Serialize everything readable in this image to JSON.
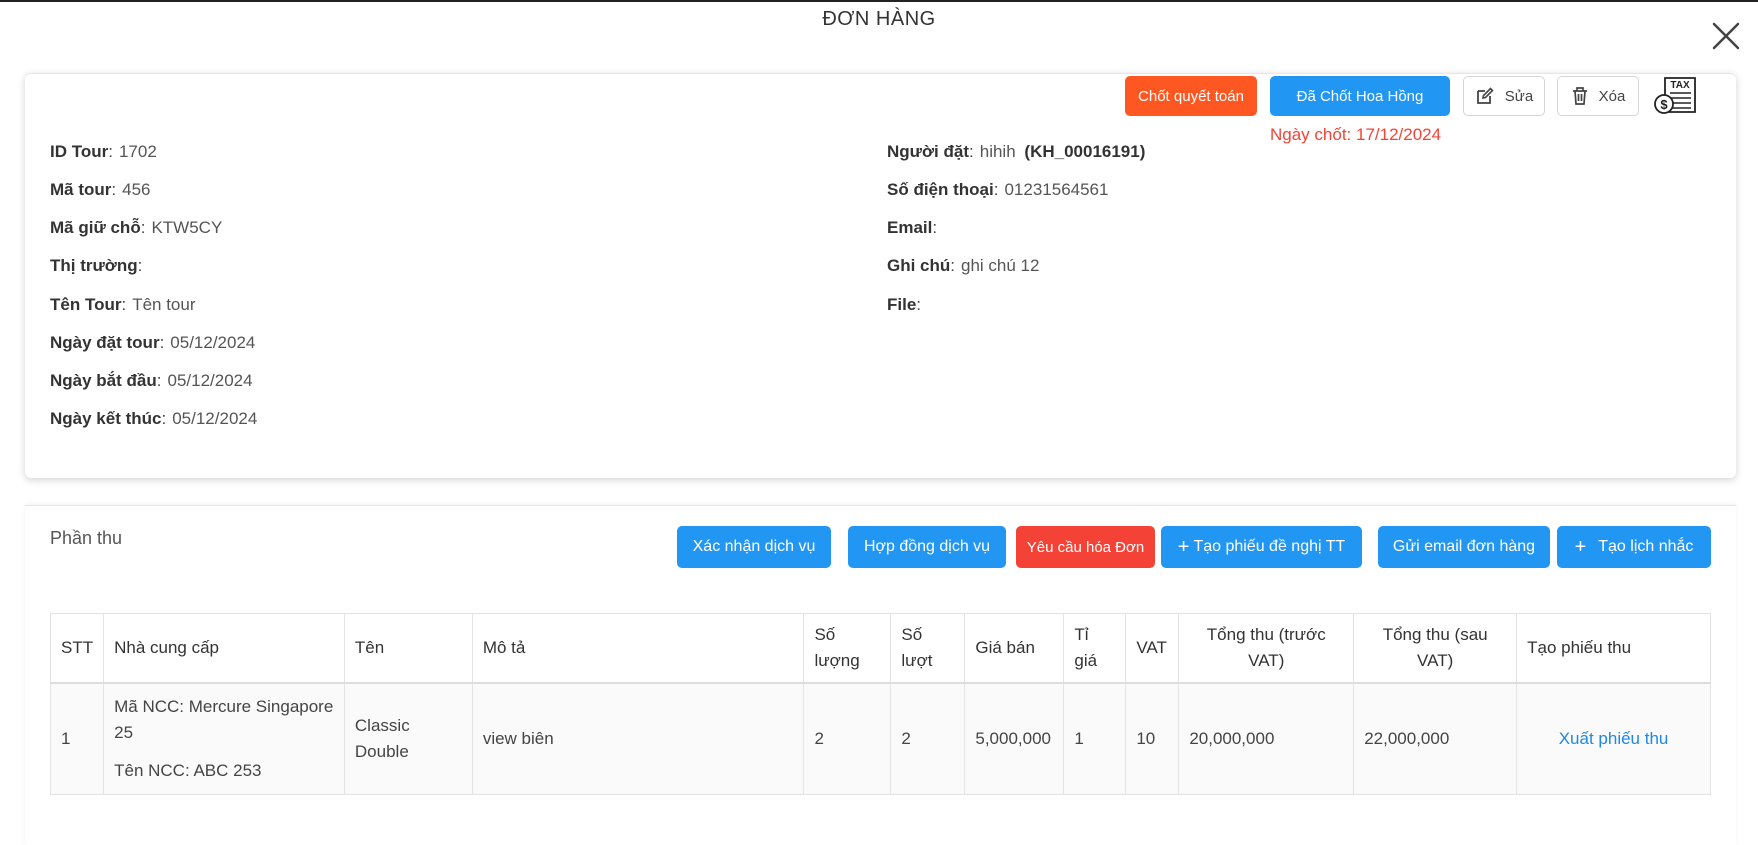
{
  "modal": {
    "title": "ĐƠN HÀNG"
  },
  "actions": {
    "settle": "Chốt quyết toán",
    "commission": "Đã Chốt Hoa Hồng",
    "edit": "Sửa",
    "delete": "Xóa",
    "closed_date": "Ngày chốt: 17/12/2024"
  },
  "tour": {
    "id_label": "ID Tour",
    "id": "1702",
    "code_label": "Mã tour",
    "code": "456",
    "hold_label": "Mã giữ chỗ",
    "hold": "KTW5CY",
    "market_label": "Thị trường",
    "market": "",
    "name_label": "Tên Tour",
    "name": "Tên tour",
    "booked_label": "Ngày đặt tour",
    "booked": "05/12/2024",
    "start_label": "Ngày bắt đầu",
    "start": "05/12/2024",
    "end_label": "Ngày kết thúc",
    "end": "05/12/2024"
  },
  "customer": {
    "booker_label": "Người đặt",
    "booker": "hihih",
    "booker_code": "(KH_00016191)",
    "phone_label": "Số điện thoại",
    "phone": "01231564561",
    "email_label": "Email",
    "email": "",
    "note_label": "Ghi chú",
    "note": "ghi chú 12",
    "file_label": "File",
    "file": ""
  },
  "receipts": {
    "title": "Phần thu",
    "buttons": {
      "confirm": "Xác nhận dịch vụ",
      "contract": "Hợp đồng dịch vụ",
      "invoice": "Yêu cầu hóa Đơn",
      "payment_request": "Tạo phiếu đề nghị TT",
      "email": "Gửi email đơn hàng",
      "reminder": "Tạo lịch nhắc"
    },
    "columns": {
      "stt": "STT",
      "supplier": "Nhà cung cấp",
      "name": "Tên",
      "desc": "Mô tả",
      "qty": "Số lượng",
      "turns": "Số lượt",
      "price": "Giá bán",
      "rate": "Tỉ giá",
      "vat": "VAT",
      "total_pre": "Tổng thu (trước VAT)",
      "total_post": "Tổng thu (sau VAT)",
      "create": "Tạo phiếu thu"
    },
    "rows": [
      {
        "stt": "1",
        "supplier_code": "Mã NCC: Mercure Singapore 25",
        "supplier_name": "Tên NCC: ABC 253",
        "name": "Classic Double",
        "desc": "view biên",
        "qty": "2",
        "turns": "2",
        "price": "5,000,000",
        "rate": "1",
        "vat": "10",
        "total_pre": "20,000,000",
        "total_post": "22,000,000",
        "action": "Xuất phiếu thu"
      }
    ]
  }
}
